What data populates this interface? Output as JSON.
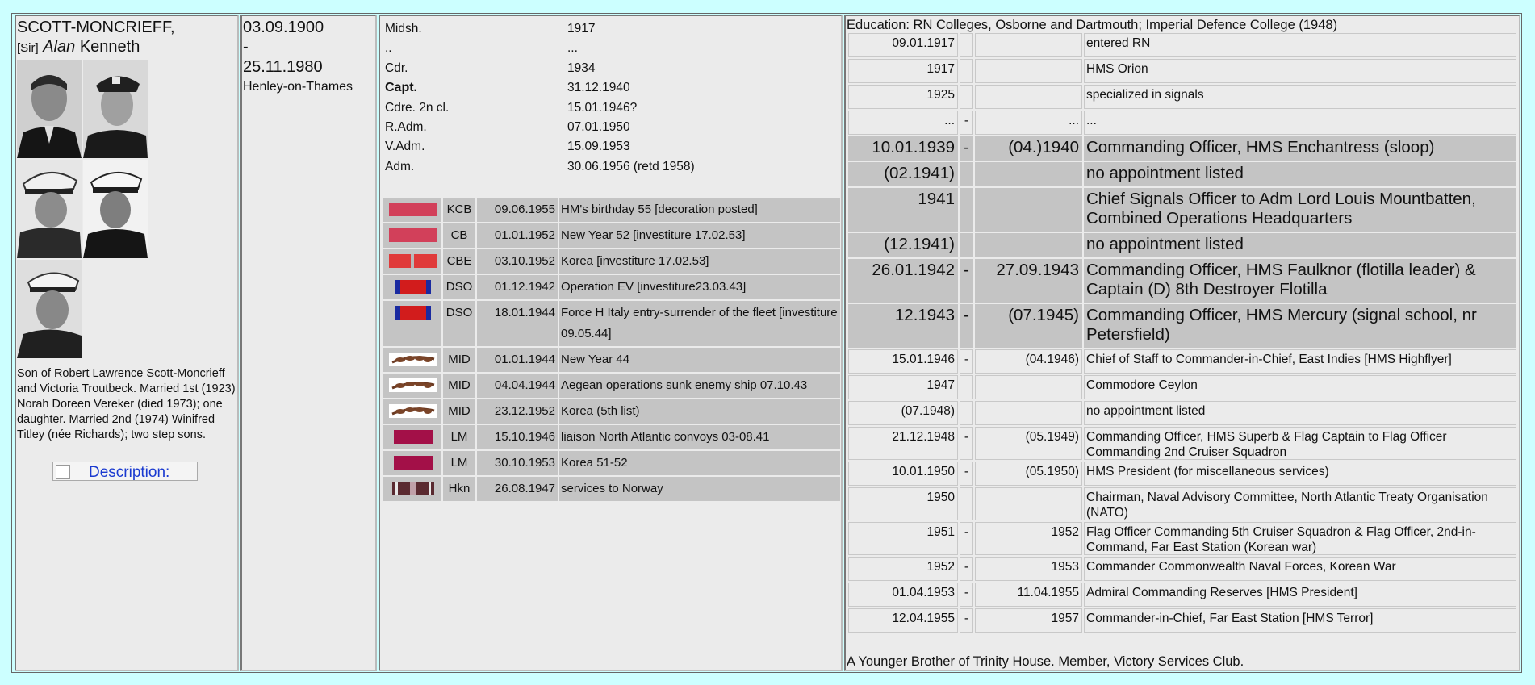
{
  "person": {
    "surname": "SCOTT-MONCRIEFF,",
    "title": "[Sir]",
    "first": "Alan",
    "middle": "Kenneth",
    "born": "03.09.1900",
    "dash": "-",
    "died": "25.11.1980",
    "place": "Henley-on-Thames",
    "bio": "Son of Robert Lawrence Scott-Moncrieff and Victoria Troutbeck. Married 1st (1923) Norah Doreen Vereker (died 1973); one daughter. Married 2nd (1974) Winifred Titley (née Richards); two step sons.",
    "description_label": "Description:"
  },
  "ranks": [
    {
      "rank": "Midsh.",
      "date": "1917"
    },
    {
      "rank": "..",
      "date": "..."
    },
    {
      "rank": "Cdr.",
      "date": "1934"
    },
    {
      "rank": "Capt.",
      "date": "31.12.1940",
      "bold": true
    },
    {
      "rank": "Cdre. 2n cl.",
      "date": "15.01.1946?"
    },
    {
      "rank": "R.Adm.",
      "date": "07.01.1950"
    },
    {
      "rank": "V.Adm.",
      "date": "15.09.1953"
    },
    {
      "rank": "Adm.",
      "date": "30.06.1956 (retd 1958)"
    }
  ],
  "awards": [
    {
      "abbr": "KCB",
      "date": "09.06.1955",
      "text": "HM's birthday 55 [decoration posted]",
      "ribbon": "kcb"
    },
    {
      "abbr": "CB",
      "date": "01.01.1952",
      "text": "New Year 52 [investiture 17.02.53]",
      "ribbon": "cb"
    },
    {
      "abbr": "CBE",
      "date": "03.10.1952",
      "text": "Korea [investiture 17.02.53]",
      "ribbon": "cbe"
    },
    {
      "abbr": "DSO",
      "date": "01.12.1942",
      "text": "Operation EV [investiture23.03.43]",
      "ribbon": "dso"
    },
    {
      "abbr": "DSO",
      "date": "18.01.1944",
      "text": "Force H Italy entry-surrender of the fleet [investiture 09.05.44]",
      "ribbon": "dso",
      "tall": true
    },
    {
      "abbr": "MID",
      "date": "01.01.1944",
      "text": "New Year 44",
      "ribbon": "mid"
    },
    {
      "abbr": "MID",
      "date": "04.04.1944",
      "text": "Aegean operations sunk enemy ship 07.10.43",
      "ribbon": "mid"
    },
    {
      "abbr": "MID",
      "date": "23.12.1952",
      "text": "Korea (5th list)",
      "ribbon": "mid"
    },
    {
      "abbr": "LM",
      "date": "15.10.1946",
      "text": "liaison North Atlantic convoys 03-08.41",
      "ribbon": "lm"
    },
    {
      "abbr": "LM",
      "date": "30.10.1953",
      "text": "Korea 51-52",
      "ribbon": "lm"
    },
    {
      "abbr": "Hkn",
      "date": "26.08.1947",
      "text": "services to Norway",
      "ribbon": "hkn"
    }
  ],
  "education": "Education: RN Colleges, Osborne and Dartmouth; Imperial Defence College (1948)",
  "career": [
    {
      "from": "09.01.1917",
      "sep": "",
      "to": "",
      "text": "entered RN",
      "h": 30
    },
    {
      "from": "1917",
      "sep": "",
      "to": "",
      "text": "HMS Orion",
      "h": 30
    },
    {
      "from": "1925",
      "sep": "",
      "to": "",
      "text": "specialized in signals",
      "h": 30
    },
    {
      "from": "...",
      "sep": "-",
      "to": "...",
      "text": "...",
      "h": 30
    },
    {
      "from": "10.01.1939",
      "sep": "-",
      "to": "(04.)1940",
      "text": "Commanding Officer, HMS Enchantress (sloop)",
      "h": 30,
      "big": true
    },
    {
      "from": "(02.1941)",
      "sep": "",
      "to": "",
      "text": "no appointment listed",
      "h": 30,
      "big": true
    },
    {
      "from": "1941",
      "sep": "",
      "to": "",
      "text": "Chief Signals Officer to Adm Lord Louis Mountbatten, Combined Operations Headquarters",
      "h": 54,
      "big": true
    },
    {
      "from": "(12.1941)",
      "sep": "",
      "to": "",
      "text": "no appointment listed",
      "h": 30,
      "big": true
    },
    {
      "from": "26.01.1942",
      "sep": "-",
      "to": "27.09.1943",
      "text": "Commanding Officer, HMS Faulknor (flotilla leader) & Captain (D) 8th Destroyer Flotilla",
      "h": 54,
      "big": true
    },
    {
      "from": "12.1943",
      "sep": "-",
      "to": "(07.1945)",
      "text": "Commanding Officer, HMS Mercury (signal school, nr Petersfield)",
      "h": 54,
      "big": true
    },
    {
      "from": "15.01.1946",
      "sep": "-",
      "to": "(04.1946)",
      "text": "Chief of Staff to Commander-in-Chief, East Indies [HMS Highflyer]",
      "h": 30
    },
    {
      "from": "1947",
      "sep": "",
      "to": "",
      "text": "Commodore Ceylon",
      "h": 30
    },
    {
      "from": "(07.1948)",
      "sep": "",
      "to": "",
      "text": "no appointment listed",
      "h": 30
    },
    {
      "from": "21.12.1948",
      "sep": "-",
      "to": "(05.1949)",
      "text": "Commanding Officer, HMS Superb & Flag Captain to Flag Officer Commanding 2nd Cruiser Squadron",
      "h": 41
    },
    {
      "from": "10.01.1950",
      "sep": "-",
      "to": "(05.1950)",
      "text": "HMS President (for miscellaneous services)",
      "h": 30
    },
    {
      "from": "1950",
      "sep": "",
      "to": "",
      "text": "Chairman, Naval Advisory Committee, North Atlantic Treaty Organisation (NATO)",
      "h": 41
    },
    {
      "from": "1951",
      "sep": "-",
      "to": "1952",
      "text": "Flag Officer Commanding 5th Cruiser Squadron & Flag Officer, 2nd-in-Command, Far East Station (Korean war)",
      "h": 41
    },
    {
      "from": "1952",
      "sep": "-",
      "to": "1953",
      "text": "Commander Commonwealth Naval Forces, Korean War",
      "h": 30
    },
    {
      "from": "01.04.1953",
      "sep": "-",
      "to": "11.04.1955",
      "text": "Admiral Commanding Reserves [HMS President]",
      "h": 30
    },
    {
      "from": "12.04.1955",
      "sep": "-",
      "to": "1957",
      "text": "Commander-in-Chief, Far East Station [HMS Terror]",
      "h": 30
    }
  ],
  "footer": "A Younger Brother of Trinity House. Member, Victory Services Club.",
  "colors": {
    "background": "#ccffff",
    "cell": "#ebebeb",
    "highlight": "#c4c4c4",
    "link": "#1a3ad0"
  }
}
